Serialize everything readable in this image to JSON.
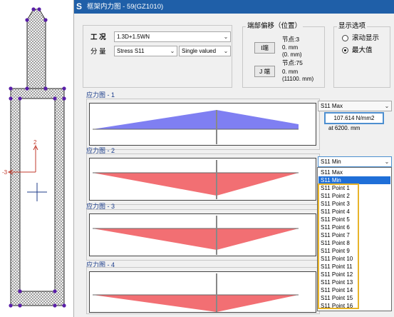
{
  "window": {
    "icon": "S",
    "title": "框架内力图 - 59(GZ1010)"
  },
  "load_group": {
    "case_label": "工 况",
    "case_value": "1.3D+1.5WN",
    "component_label": "分 量",
    "component_value": "Stress S11",
    "value_mode": "Single valued"
  },
  "end_offset": {
    "title": "端部偏移（位置）",
    "i_button": "I端",
    "i_node": "节点:3",
    "i_offset": "0. mm",
    "i_position": "(0. mm)",
    "j_button": "J 端",
    "j_node": "节点:75",
    "j_offset": "0. mm",
    "j_position": "(11100. mm)"
  },
  "display_options": {
    "title": "显示选项",
    "scroll_display": "滚动显示",
    "max_value": "最大值",
    "selected": "max_value"
  },
  "charts": [
    {
      "label": "应力图 - 1",
      "selector": "S11 Max"
    },
    {
      "label": "应力图 - 2",
      "selector": "S11 Min"
    },
    {
      "label": "应力图 - 3"
    },
    {
      "label": "应力图 - 4"
    }
  ],
  "readout": {
    "value": "107.614 N/mm2",
    "location": "at 6200. mm"
  },
  "dropdown": {
    "items": [
      "S11 Max",
      "S11 Min",
      "S11 Point 1",
      "S11 Point 2",
      "S11 Point 3",
      "S11 Point 4",
      "S11 Point 5",
      "S11 Point 6",
      "S11 Point 7",
      "S11 Point 8",
      "S11 Point 9",
      "S11 Point 10",
      "S11 Point 11",
      "S11 Point 12",
      "S11 Point 13",
      "S11 Point 14",
      "S11 Point 15",
      "S11 Point 16"
    ],
    "selected": "S11 Min"
  },
  "section": {
    "axis_2": "2",
    "axis_3": "-3"
  },
  "colors": {
    "title_bar": "#1f5fa8",
    "positive_fill": "#7f7ff2",
    "negative_fill": "#f26f73",
    "selection": "#1f6fd8",
    "highlight": "#e8b42a",
    "node_dot": "#5a1fa8"
  }
}
